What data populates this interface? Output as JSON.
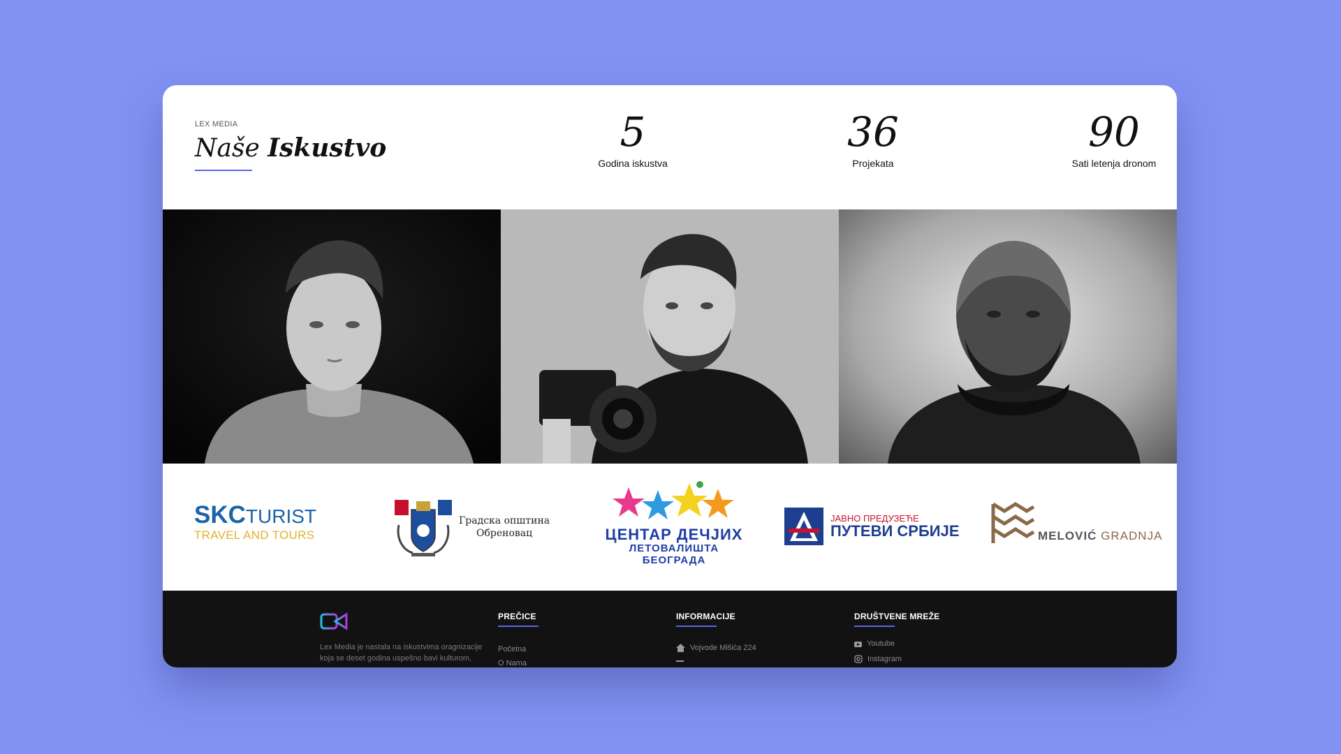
{
  "experience": {
    "eyebrow": "LEX MEDIA",
    "heading_light": "Naše",
    "heading_bold": "Iskustvo",
    "stats": [
      {
        "number": "5",
        "label": "Godina iskustva"
      },
      {
        "number": "36",
        "label": "Projekata"
      },
      {
        "number": "90",
        "label": "Sati letenja dronom"
      }
    ]
  },
  "partners": {
    "skc": {
      "name": "SKC",
      "name2": "TURIST",
      "tagline": "TRAVEL AND TOURS"
    },
    "obrenovac": {
      "line1": "Градска општина",
      "line2": "Обреновац"
    },
    "centar": {
      "line1": "ЦЕНТАР ДЕЧЈИХ",
      "line2": "ЛЕТОВАЛИШТА БЕОГРАДА"
    },
    "putevi": {
      "line1": "ЈАВНО ПРЕДУЗЕЋЕ",
      "line2": "ПУТЕВИ СРБИЈЕ"
    },
    "melovic": {
      "line1": "MELOVIĆ",
      "line2": "GRADNJA"
    }
  },
  "footer": {
    "about": "Lex Media je nastala na iskustvima oragnizacije koja se deset godina uspešno bavi kulturom,",
    "shortcuts": {
      "heading": "PREČICE",
      "links": [
        "Početna",
        "O Nama"
      ]
    },
    "info": {
      "heading": "INFORMACIJE",
      "address": "Vojvode Mišića 224"
    },
    "social": {
      "heading": "DRUŠTVENE MREŽE",
      "links": [
        "Youtube",
        "Instagram"
      ]
    }
  },
  "colors": {
    "background": "#8292f3",
    "accent": "#5b63e6",
    "footer": "#121212"
  }
}
